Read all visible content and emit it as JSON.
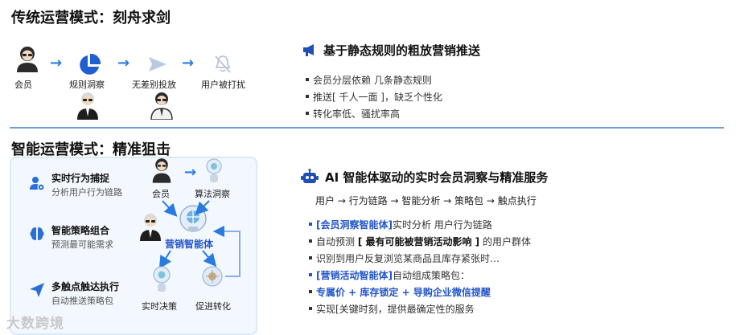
{
  "traditional": {
    "title": "传统运营模式：刻舟求剑",
    "flow": [
      "会员",
      "规则洞察",
      "无差别投放",
      "用户被打扰"
    ],
    "heading_icon": "megaphone-icon",
    "heading": "基于静态规则的粗放营销推送",
    "bullets": [
      "会员分层依赖 几条静态规则",
      "推送[ 千人一面 ]，缺乏个性化",
      "转化率低、骚扰率高"
    ]
  },
  "smart": {
    "title": "智能运营模式：精准狙击",
    "features": [
      {
        "icon": "user-gear-icon",
        "title": "实时行为捕捉",
        "subtitle": "分析用户行为链路"
      },
      {
        "icon": "brain-icon",
        "title": "智能策略组合",
        "subtitle": "预测最可能需求"
      },
      {
        "icon": "send-icon",
        "title": "多触点触达执行",
        "subtitle": "自动推送策略包"
      }
    ],
    "diagram": {
      "member": "会员",
      "algorithm": "算法洞察",
      "center": "营销智能体",
      "decision": "实时决策",
      "conversion": "促进转化"
    },
    "heading_icon": "robot-icon",
    "heading": "AI 智能体驱动的实时会员洞察与精准服务",
    "chain": "用户 → 行为链路 → 智能分析 → 策略包 → 触点执行",
    "bullets": [
      {
        "parts": [
          {
            "t": "[会员洞察智能体]",
            "s": "bb"
          },
          {
            "t": "实时分析 用户行为链路",
            "s": ""
          }
        ]
      },
      {
        "parts": [
          {
            "t": "自动预测 ",
            "s": ""
          },
          {
            "t": "[ 最有可能被营销活动影响 ]",
            "s": "b"
          },
          {
            "t": " 的用户群体",
            "s": ""
          }
        ]
      },
      {
        "parts": [
          {
            "t": "识别到用户反复浏览某商品且库存紧张时…",
            "s": ""
          }
        ]
      },
      {
        "parts": [
          {
            "t": "[营销活动智能体]",
            "s": "bb"
          },
          {
            "t": "自动组成策略包：",
            "s": ""
          }
        ]
      },
      {
        "parts": [
          {
            "t": "专属价 + 库存锁定 + 导购企业微信提醒",
            "s": "bb"
          }
        ]
      },
      {
        "parts": [
          {
            "t": "实现[关键时刻，提供最确定性的服务",
            "s": ""
          }
        ]
      }
    ]
  },
  "watermark": "大数跨境",
  "colors": {
    "accent": "#2a7be0",
    "divider": "#6e9ed6",
    "highlight": "#2355c9"
  }
}
